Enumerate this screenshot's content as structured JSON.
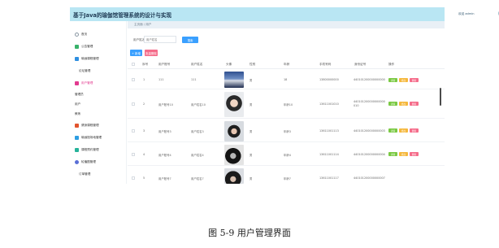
{
  "app": {
    "title": "基于Java的瑜伽馆管理系统的设计与实现",
    "welcome": "欢迎 admin"
  },
  "breadcrumb": [
    "主页面",
    "用户"
  ],
  "sidebar": {
    "items": [
      {
        "label": "首页",
        "color": "#8a97a3"
      },
      {
        "label": "公告管理",
        "color": "#38b26a"
      },
      {
        "label": "瑜伽课程管理",
        "color": "#2f8fe0"
      },
      {
        "label": "论坛管理",
        "color": ""
      },
      {
        "label": "用户管理",
        "color": "#e23a8f"
      },
      {
        "label": "管理员",
        "color": ""
      },
      {
        "label": "用户",
        "color": ""
      },
      {
        "label": "教练",
        "color": ""
      },
      {
        "label": "健身课程管理",
        "color": "#e2542e"
      },
      {
        "label": "瑜伽馆场地管理",
        "color": "#2e9ee2"
      },
      {
        "label": "课程预约管理",
        "color": "#26b39a"
      },
      {
        "label": "轮播图管理",
        "color": "#5a6fd6"
      },
      {
        "label": "订单管理",
        "color": ""
      }
    ]
  },
  "search": {
    "label": "用户姓名",
    "placeholder": "用户姓名",
    "button": "搜索"
  },
  "toolbar": {
    "add": "+ 新增",
    "delete": "批量删除"
  },
  "table": {
    "columns": [
      "序号",
      "用户账号",
      "用户姓名",
      "头像",
      "性别",
      "年龄",
      "手机号码",
      "身份证号",
      "操作"
    ],
    "rows": [
      {
        "index": "1",
        "account": "111",
        "name": "111",
        "gender": "男",
        "age": "18",
        "phone": "13800000000",
        "idcard": "440101200000000000"
      },
      {
        "index": "2",
        "account": "用户账号10",
        "name": "用户姓名10",
        "gender": "男",
        "age": "年龄10",
        "phone": "13611001010",
        "idcard": "440101200000000000010"
      },
      {
        "index": "3",
        "account": "用户账号3",
        "name": "用户姓名3",
        "gender": "男",
        "age": "年龄3",
        "phone": "13611001113",
        "idcard": "440101200000000003"
      },
      {
        "index": "4",
        "account": "用户账号4",
        "name": "用户姓名4",
        "gender": "男",
        "age": "年龄4",
        "phone": "13611001114",
        "idcard": "440101200000000004"
      },
      {
        "index": "5",
        "account": "用户账号7",
        "name": "用户姓名7",
        "gender": "男",
        "age": "年龄7",
        "phone": "13611001117",
        "idcard": "440101200000000007"
      }
    ],
    "actions": {
      "detail": "详情",
      "edit": "修改",
      "delete": "删除"
    }
  },
  "colors": {
    "topbar": "#b9e6f3",
    "primary": "#3aa0ff",
    "danger": "#f56c8a",
    "success": "#7ac943",
    "warning": "#f5b83d"
  },
  "caption": "图  5-9 用户管理界面"
}
